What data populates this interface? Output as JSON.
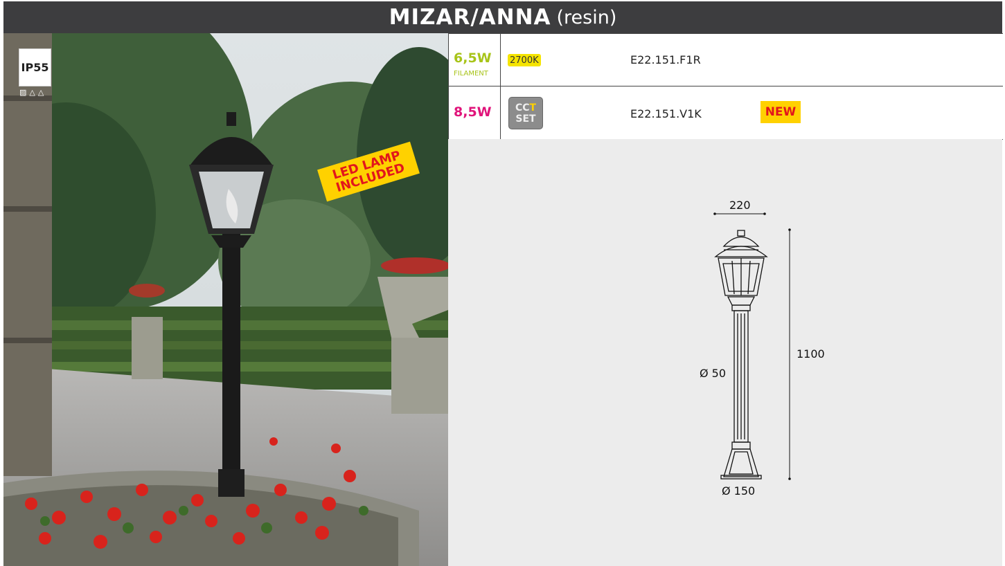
{
  "header": {
    "name": "MIZAR/ANNA",
    "material": "(resin)"
  },
  "photo": {
    "ip_rating": "IP55",
    "led_stamp": {
      "line1": "LED LAMP",
      "line2": "INCLUDED"
    }
  },
  "table": {
    "rows": [
      {
        "wattage": "6,5W",
        "subtitle": "FILAMENT",
        "temperature": "2700K",
        "code": "E22.151.F1R"
      },
      {
        "wattage": "8,5W",
        "cct_line1_a": "CC",
        "cct_line1_b": "T",
        "cct_line2": "SET",
        "code": "E22.151.V1K",
        "badge": "NEW"
      }
    ]
  },
  "drawing": {
    "width": "220",
    "height": "1100",
    "pole_diameter": "Ø 50",
    "base_diameter": "Ø 150"
  },
  "colors": {
    "header_bg": "#3d3d3f",
    "green_wattage": "#a8c41a",
    "magenta_wattage": "#e0147a",
    "stamp_yellow": "#ffd100",
    "stamp_red": "#e2161c"
  }
}
